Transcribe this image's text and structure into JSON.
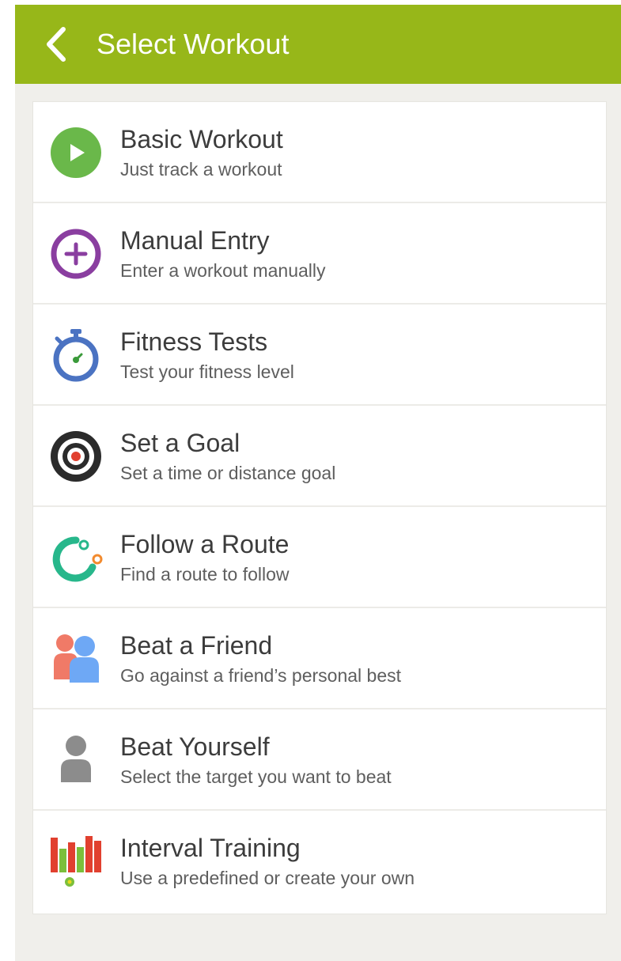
{
  "header": {
    "title": "Select Workout"
  },
  "items": [
    {
      "title": "Basic Workout",
      "subtitle": "Just track a workout",
      "icon": "play-circle-icon",
      "color": "#6ab84a"
    },
    {
      "title": "Manual Entry",
      "subtitle": "Enter a workout manually",
      "icon": "plus-circle-icon",
      "color": "#8a3ea0"
    },
    {
      "title": "Fitness Tests",
      "subtitle": "Test your fitness level",
      "icon": "stopwatch-icon",
      "color": "#4b73c2"
    },
    {
      "title": "Set a Goal",
      "subtitle": "Set a time or distance goal",
      "icon": "target-icon",
      "color": "#2b2b2b"
    },
    {
      "title": "Follow a Route",
      "subtitle": "Find a route to follow",
      "icon": "route-icon",
      "color": "#27b78b"
    },
    {
      "title": "Beat a Friend",
      "subtitle": "Go against a friend’s personal best",
      "icon": "friends-icon",
      "color": "#6ea8f5"
    },
    {
      "title": "Beat Yourself",
      "subtitle": "Select the target you want to beat",
      "icon": "person-icon",
      "color": "#8c8c8c"
    },
    {
      "title": "Interval Training",
      "subtitle": "Use a predefined or create your own",
      "icon": "interval-bars-icon",
      "color": "#e1402f"
    }
  ]
}
